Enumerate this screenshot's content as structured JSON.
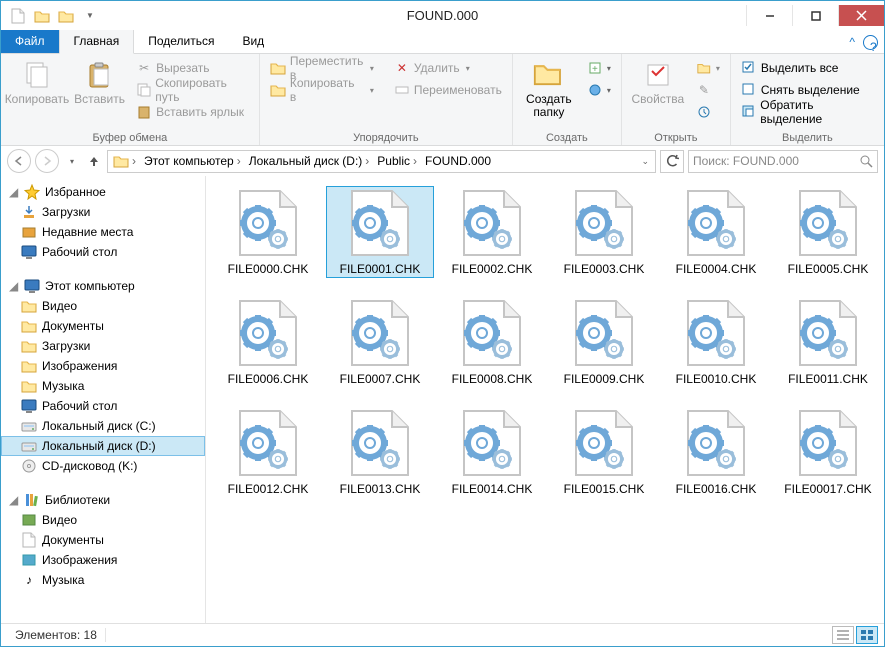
{
  "window": {
    "title": "FOUND.000"
  },
  "tabs": {
    "file": "Файл",
    "home": "Главная",
    "share": "Поделиться",
    "view": "Вид"
  },
  "ribbon": {
    "clipboard": {
      "copy": "Копировать",
      "paste": "Вставить",
      "cut": "Вырезать",
      "copypath": "Скопировать путь",
      "pasteshortcut": "Вставить ярлык",
      "label": "Буфер обмена"
    },
    "organize": {
      "moveto": "Переместить в",
      "copyto": "Копировать в",
      "delete": "Удалить",
      "rename": "Переименовать",
      "label": "Упорядочить"
    },
    "new": {
      "newfolder": "Создать папку",
      "label": "Создать"
    },
    "open": {
      "properties": "Свойства",
      "label": "Открыть"
    },
    "select": {
      "selectall": "Выделить все",
      "selectnone": "Снять выделение",
      "invert": "Обратить выделение",
      "label": "Выделить"
    }
  },
  "breadcrumb": {
    "pc": "Этот компьютер",
    "drive": "Локальный диск (D:)",
    "public": "Public",
    "found": "FOUND.000"
  },
  "search": {
    "placeholder": "Поиск: FOUND.000"
  },
  "nav": {
    "favorites": {
      "header": "Избранное",
      "downloads": "Загрузки",
      "recent": "Недавние места",
      "desktop": "Рабочий стол"
    },
    "pc": {
      "header": "Этот компьютер",
      "videos": "Видео",
      "documents": "Документы",
      "downloads": "Загрузки",
      "pictures": "Изображения",
      "music": "Музыка",
      "desktop": "Рабочий стол",
      "drivec": "Локальный диск (C:)",
      "drived": "Локальный диск (D:)",
      "cdrom": "CD-дисковод (K:)"
    },
    "libraries": {
      "header": "Библиотеки",
      "videos": "Видео",
      "documents": "Документы",
      "pictures": "Изображения",
      "music": "Музыка"
    }
  },
  "files": [
    "FILE0000.CHK",
    "FILE0001.CHK",
    "FILE0002.CHK",
    "FILE0003.CHK",
    "FILE0004.CHK",
    "FILE0005.CHK",
    "FILE0006.CHK",
    "FILE0007.CHK",
    "FILE0008.CHK",
    "FILE0009.CHK",
    "FILE0010.CHK",
    "FILE0011.CHK",
    "FILE0012.CHK",
    "FILE0013.CHK",
    "FILE0014.CHK",
    "FILE0015.CHK",
    "FILE0016.CHK",
    "FILE00017.CHK"
  ],
  "selected_file_index": 1,
  "status": {
    "count": "Элементов: 18"
  }
}
